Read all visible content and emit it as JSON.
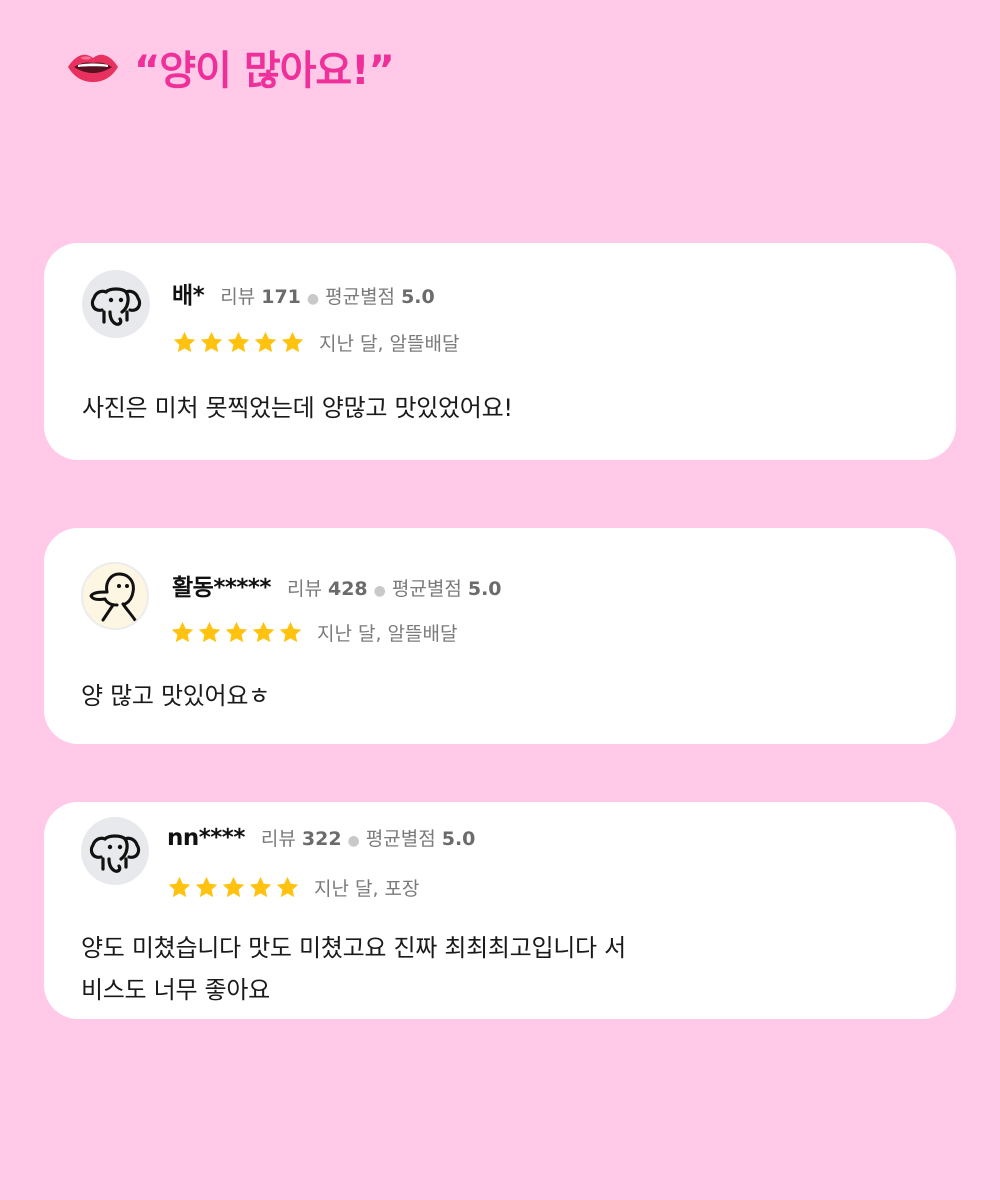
{
  "headline": {
    "icon": "lips-icon",
    "text": "“양이 많아요!”",
    "color": "#f0309a"
  },
  "reviews": [
    {
      "avatar": "elephant-avatar-icon",
      "nickname": "배*",
      "review_count_label": "리뷰",
      "review_count": "171",
      "avg_rating_label": "평균별점",
      "avg_rating": "5.0",
      "stars": 5,
      "when": "지난 달, 알뜰배달",
      "text_lines": [
        "사진은 미처 못찍었는데 양많고 맛있었어요!"
      ]
    },
    {
      "avatar": "character-avatar-icon",
      "nickname": "활동*****",
      "review_count_label": "리뷰",
      "review_count": "428",
      "avg_rating_label": "평균별점",
      "avg_rating": "5.0",
      "stars": 5,
      "when": "지난 달, 알뜰배달",
      "text_lines": [
        "양 많고 맛있어요ㅎ"
      ]
    },
    {
      "avatar": "elephant-avatar-icon",
      "nickname": "nn****",
      "review_count_label": "리뷰",
      "review_count": "322",
      "avg_rating_label": "평균별점",
      "avg_rating": "5.0",
      "stars": 5,
      "when": "지난 달, 포장",
      "text_lines": [
        "양도 미쳤습니다 맛도 미쳤고요 진짜 최최최고입니다 서",
        "비스도 너무 좋아요"
      ]
    }
  ],
  "colors": {
    "background": "#ffc9e7",
    "star": "#ffc20e",
    "card": "#ffffff"
  }
}
